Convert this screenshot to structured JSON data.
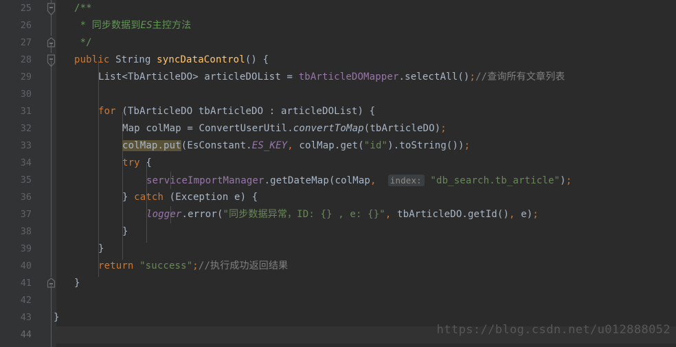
{
  "editor": {
    "theme_name": "darcula",
    "background": "#2b2b2b",
    "gutter_background": "#313335",
    "caret_line_background": "#323232",
    "line_number_color": "#606366",
    "first_line": 25,
    "last_line": 44,
    "caret_line": 44,
    "line_numbers": [
      "25",
      "26",
      "27",
      "28",
      "29",
      "30",
      "31",
      "32",
      "33",
      "34",
      "35",
      "36",
      "37",
      "38",
      "39",
      "40",
      "41",
      "42",
      "43",
      "44"
    ],
    "fold_markers": [
      {
        "line": 25,
        "type": "fold-start-expanded",
        "name": "fold-marker-comment-start"
      },
      {
        "line": 27,
        "type": "fold-end",
        "name": "fold-marker-comment-end"
      },
      {
        "line": 28,
        "type": "fold-start-expanded",
        "name": "fold-marker-method-start"
      },
      {
        "line": 41,
        "type": "fold-end",
        "name": "fold-marker-method-end"
      }
    ]
  },
  "code": {
    "lines": [
      {
        "n": "25",
        "text": "    /**"
      },
      {
        "n": "26",
        "text": "     * 同步数据到ES主控方法"
      },
      {
        "n": "27",
        "text": "     */"
      },
      {
        "n": "28",
        "text": "    public String syncDataControl() {"
      },
      {
        "n": "29",
        "text": "        List<TbArticleDO> articleDOList = tbArticleDOMapper.selectAll();//查询所有文章列表"
      },
      {
        "n": "30",
        "text": ""
      },
      {
        "n": "31",
        "text": "        for (TbArticleDO tbArticleDO : articleDOList) {"
      },
      {
        "n": "32",
        "text": "            Map colMap = ConvertUserUtil.convertToMap(tbArticleDO);"
      },
      {
        "n": "33",
        "text": "            colMap.put(EsConstant.ES_KEY, colMap.get(\"id\").toString());"
      },
      {
        "n": "34",
        "text": "            try {"
      },
      {
        "n": "35",
        "text": "                serviceImportManager.getDateMap(colMap, index: \"db_search.tb_article\");"
      },
      {
        "n": "36",
        "text": "            } catch (Exception e) {"
      },
      {
        "n": "37",
        "text": "                logger.error(\"同步数据异常，ID: {} , e: {}\", tbArticleDO.getId(), e);"
      },
      {
        "n": "38",
        "text": "            }"
      },
      {
        "n": "39",
        "text": "        }"
      },
      {
        "n": "40",
        "text": "        return \"success\";//执行成功返回结果"
      },
      {
        "n": "41",
        "text": "    }"
      },
      {
        "n": "42",
        "text": ""
      },
      {
        "n": "43",
        "text": "}"
      },
      {
        "n": "44",
        "text": ""
      }
    ],
    "highlighted_identifier": "colMap.put",
    "inline_hints": [
      {
        "line": "35",
        "label": "index:"
      }
    ],
    "comments": [
      "/**",
      "* 同步数据到ES主控方法",
      "*/",
      "//查询所有文章列表",
      "//执行成功返回结果"
    ],
    "strings": [
      "\"id\"",
      "\"db_search.tb_article\"",
      "\"同步数据异常，ID: {} , e: {}\"",
      "\"success\""
    ],
    "keywords": [
      "public",
      "for",
      "try",
      "catch",
      "return"
    ]
  },
  "syntax_colors": {
    "keyword": "#cc7832",
    "comment": "#629755",
    "line_comment": "#808080",
    "string": "#6a8759",
    "method_name": "#ffc66d",
    "field": "#9876aa",
    "default_text": "#a9b7c6",
    "caret_identifier_highlight": "#5b5338",
    "inline_hint_background": "#3c3f41",
    "inline_hint_text": "#8c8c8c"
  },
  "watermark": {
    "text": "https://blog.csdn.net/u012888052",
    "color": "#555759"
  }
}
